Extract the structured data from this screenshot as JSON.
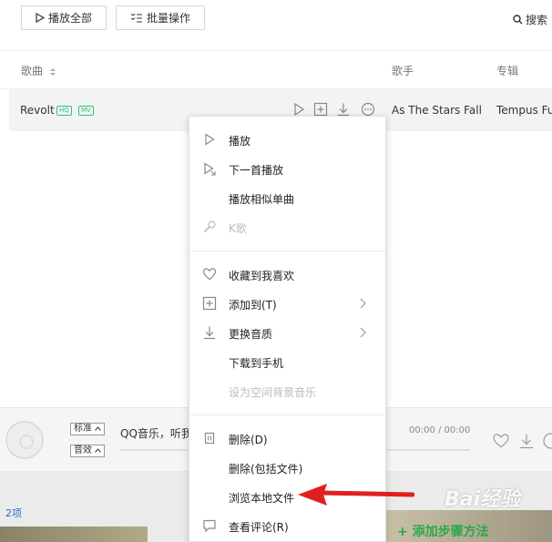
{
  "toolbar": {
    "play_all": "播放全部",
    "batch": "批量操作",
    "search": "搜索"
  },
  "table": {
    "headers": {
      "song": "歌曲",
      "singer": "歌手",
      "album": "专辑"
    },
    "row": {
      "title": "Revolt",
      "badge_hq": "HQ",
      "badge_mv": "MV",
      "singer": "As The Stars Fall",
      "album": "Tempus Fu"
    }
  },
  "menu": {
    "play": "播放",
    "next": "下一首播放",
    "similar": "播放相似单曲",
    "karaoke": "K歌",
    "favorite": "收藏到我喜欢",
    "add_to": "添加到(T)",
    "quality": "更换音质",
    "download_phone": "下载到手机",
    "set_bg": "设为空间背景音乐",
    "delete": "删除(D)",
    "delete_files": "删除(包括文件)",
    "browse_local": "浏览本地文件",
    "comments": "查看评论(R)"
  },
  "player": {
    "quality_label": "标准",
    "effect_label": "音效",
    "title": "QQ音乐，听我",
    "time": "00:00 / 00:00"
  },
  "bottom": {
    "count": "2项",
    "add_method": "+ 添加步骤方法"
  },
  "watermark": "Bai经验",
  "colors": {
    "accent_green": "#31c27c",
    "arrow_red": "#e02020",
    "link_blue": "#2a6ec0"
  }
}
